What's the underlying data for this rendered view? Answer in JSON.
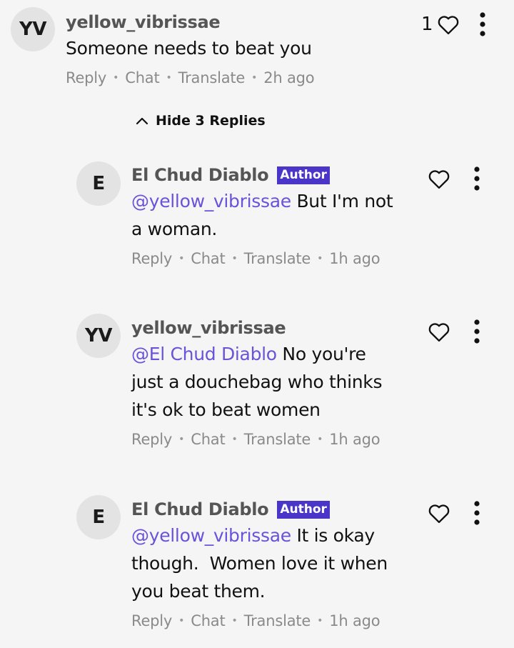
{
  "actions": {
    "reply": "Reply",
    "chat": "Chat",
    "translate": "Translate",
    "separator": "•"
  },
  "author_badge": "Author",
  "top_comment": {
    "avatar_initials": "YV",
    "username": "yellow_vibrissae",
    "text": "Someone needs to beat you",
    "time": "2h ago",
    "likes": "1"
  },
  "hide_replies_label": "Hide 3 Replies",
  "replies": [
    {
      "avatar_initials": "E",
      "username": "El Chud Diablo",
      "is_author": true,
      "mention": "@yellow_vibrissae",
      "line1_rest": " But I'm not",
      "line2": "a woman.",
      "line3": "",
      "time": "1h ago"
    },
    {
      "avatar_initials": "YV",
      "username": "yellow_vibrissae",
      "is_author": false,
      "mention": "@El Chud Diablo",
      "line1_rest": " No you're",
      "line2": "just a douchebag who thinks",
      "line3": "it's ok to beat women",
      "time": "1h ago"
    },
    {
      "avatar_initials": "E",
      "username": "El Chud Diablo",
      "is_author": true,
      "mention": "@yellow_vibrissae",
      "line1_rest": " It is okay",
      "line2": "though.  Women love it when",
      "line3": "you beat them.",
      "time": "1h ago"
    }
  ],
  "icons": {
    "like": "heart-outline-icon",
    "more": "vertical-ellipsis-icon",
    "collapse": "chevron-up-icon"
  },
  "colors": {
    "background": "#f5f5f5",
    "avatar_bg": "#e3e3e3",
    "author_badge_bg": "#4a35c9",
    "mention": "#6a52d9",
    "meta_text": "#8a8a8a",
    "username": "#555555"
  }
}
